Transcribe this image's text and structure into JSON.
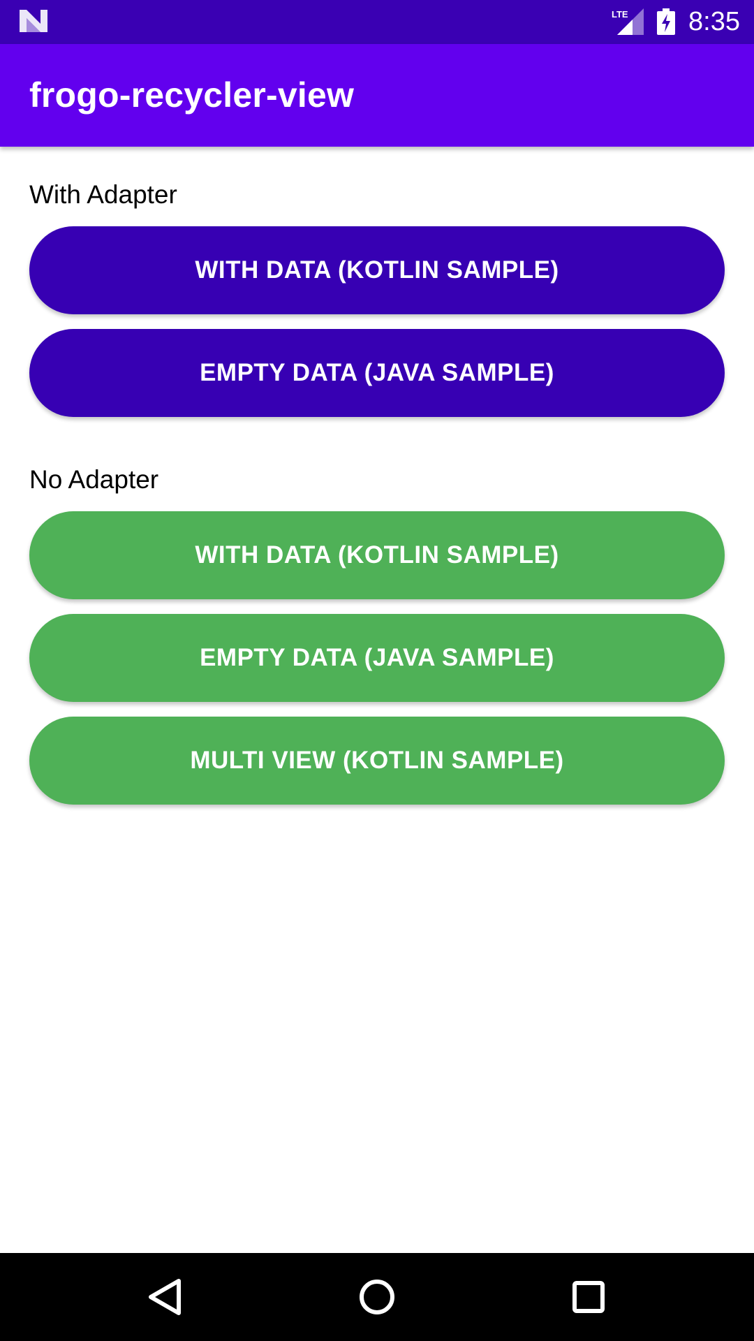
{
  "status_bar": {
    "time": "8:35",
    "network": "LTE",
    "icons": [
      "android-n-icon",
      "lte-signal-icon",
      "battery-charging-icon"
    ],
    "background": "#3a00b3"
  },
  "app_bar": {
    "title": "frogo-recycler-view",
    "background": "#6200ee"
  },
  "sections": [
    {
      "label": "With Adapter",
      "color": "#3700b3",
      "buttons": [
        {
          "label": "WITH DATA (KOTLIN SAMPLE)"
        },
        {
          "label": "EMPTY DATA (JAVA SAMPLE)"
        }
      ]
    },
    {
      "label": "No Adapter",
      "color": "#4fb157",
      "buttons": [
        {
          "label": "WITH DATA (KOTLIN SAMPLE)"
        },
        {
          "label": "EMPTY DATA (JAVA SAMPLE)"
        },
        {
          "label": "MULTI VIEW (KOTLIN SAMPLE)"
        }
      ]
    }
  ],
  "nav_bar": {
    "buttons": [
      "back-icon",
      "home-icon",
      "recents-icon"
    ]
  }
}
